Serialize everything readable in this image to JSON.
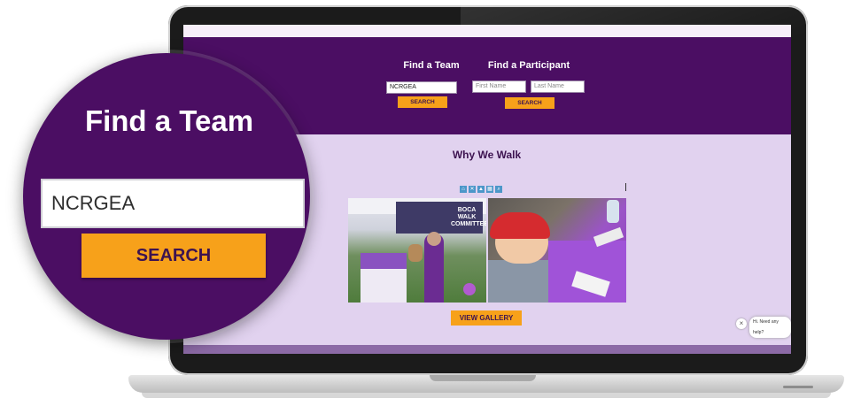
{
  "find_team": {
    "heading": "Find a Team",
    "team_value": "NCRGEA",
    "search_label": "SEARCH"
  },
  "find_participant": {
    "heading": "Find a Participant",
    "first_placeholder": "First Name",
    "last_placeholder": "Last Name",
    "search_label": "SEARCH"
  },
  "why_we_walk": {
    "heading": "Why We Walk",
    "gallery_button": "VIEW GALLERY",
    "toolbar_icons": [
      "home-icon",
      "x-icon",
      "up-icon",
      "grid-icon",
      "search-icon"
    ],
    "photo1_sign_lines": [
      "BOCA WALK",
      "COMMITTEE"
    ]
  },
  "chat": {
    "close": "×",
    "message": "Hi. Need any help?"
  },
  "zoom": {
    "heading": "Find a Team",
    "team_value": "NCRGEA",
    "search_label": "SEARCH"
  },
  "colors": {
    "purple": "#4b0e63",
    "lavender": "#e1d2ef",
    "orange": "#f7a11a"
  }
}
